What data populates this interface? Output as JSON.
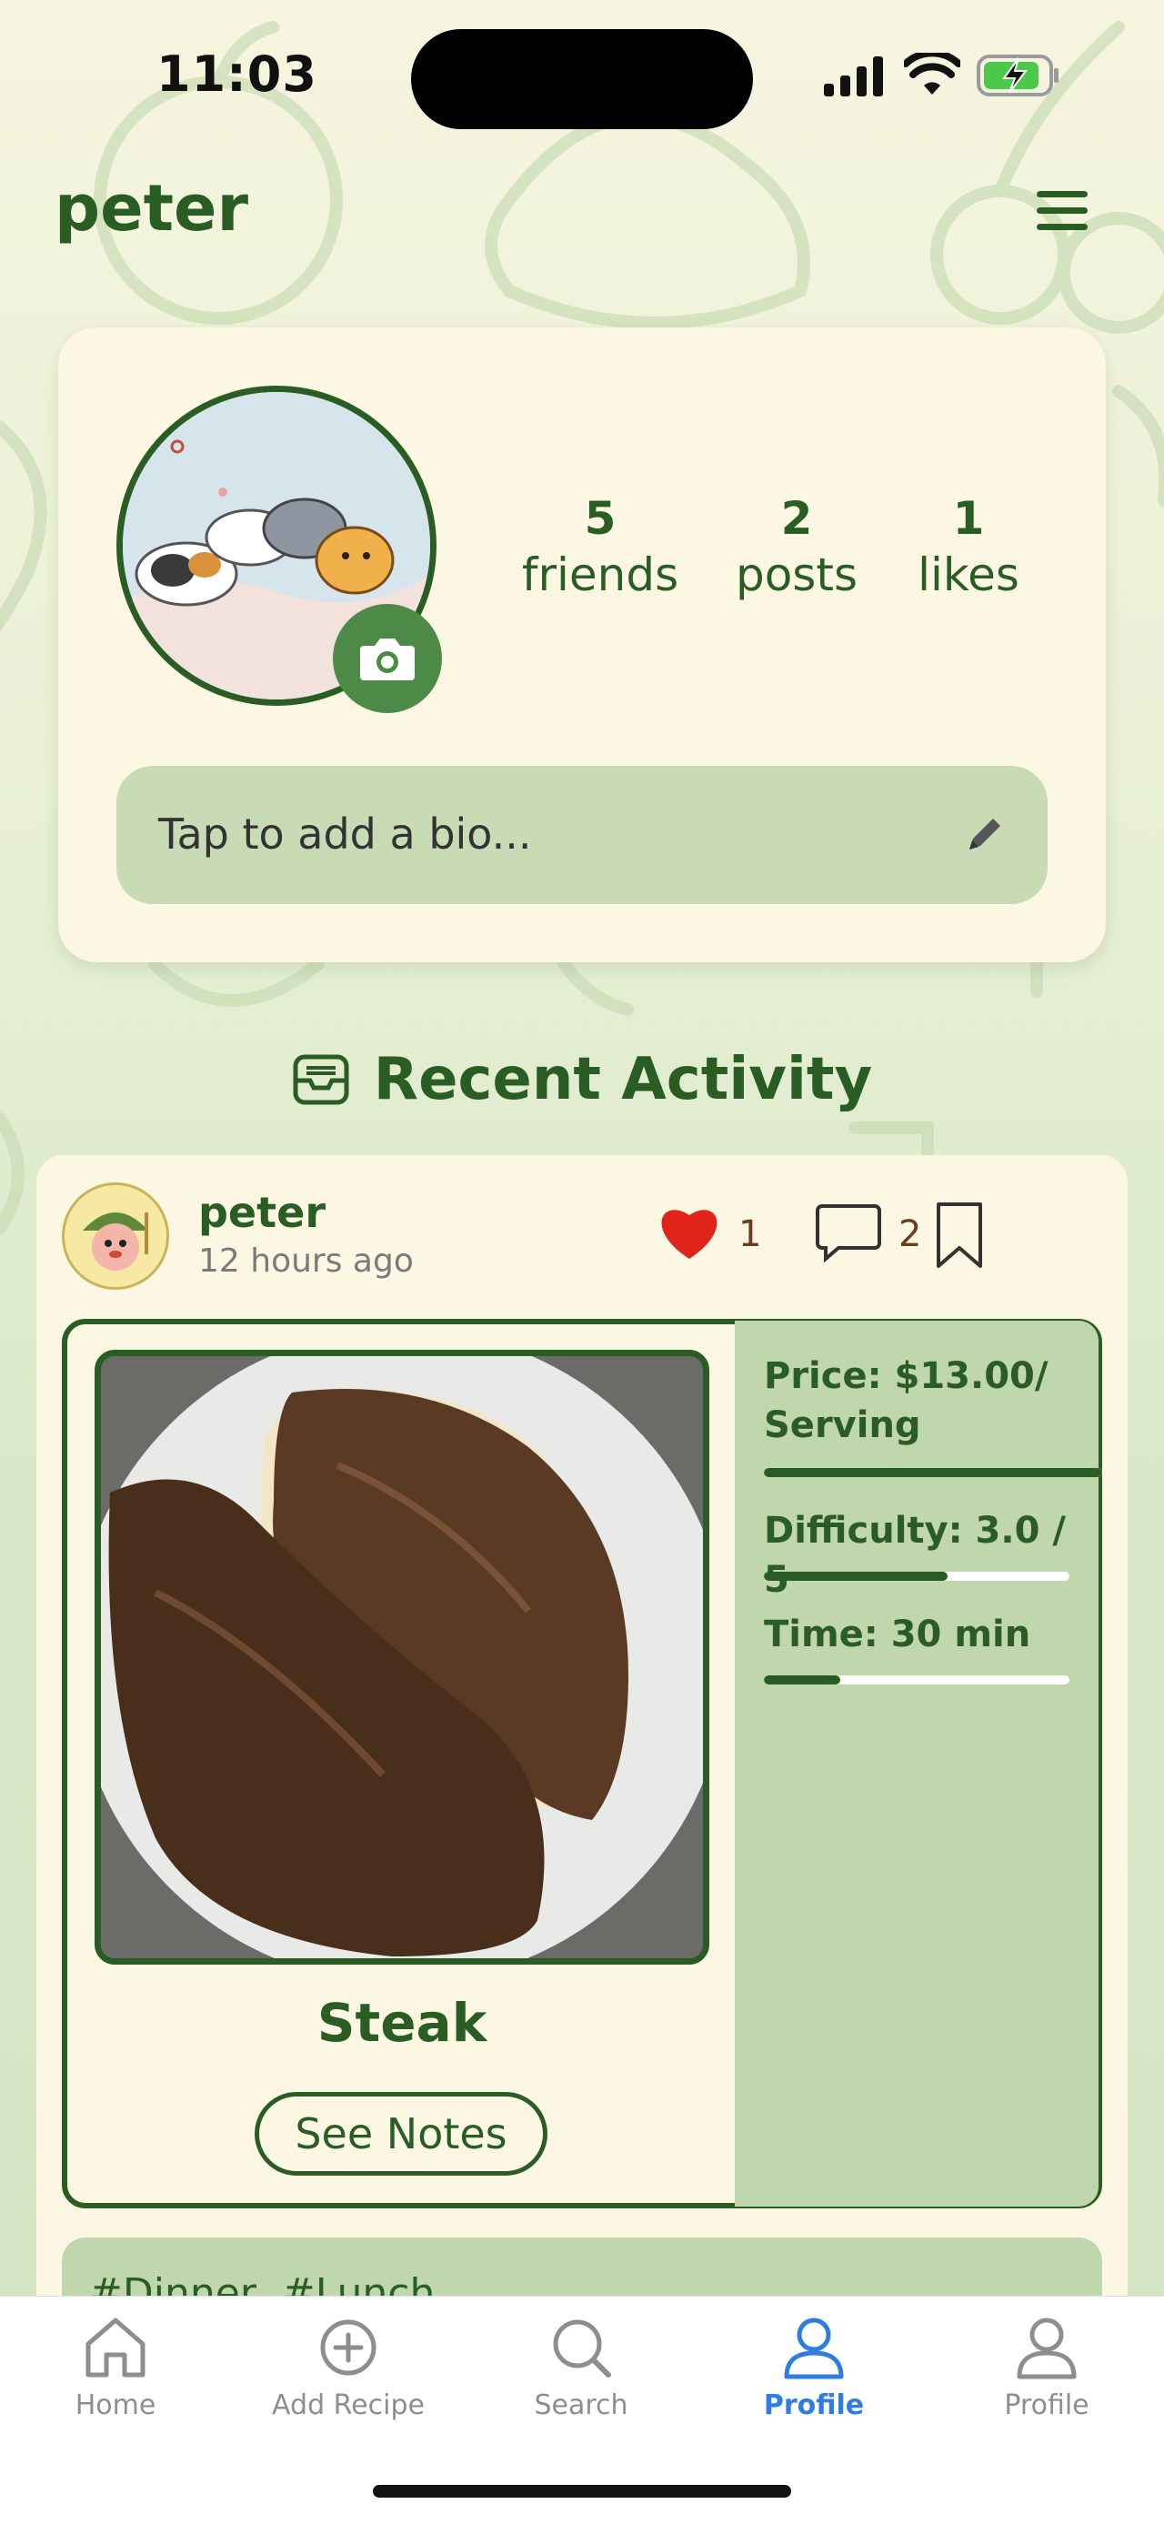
{
  "status_bar": {
    "time": "11:03"
  },
  "header": {
    "username": "peter"
  },
  "profile": {
    "stats": [
      {
        "count": "5",
        "label": "friends"
      },
      {
        "count": "2",
        "label": "posts"
      },
      {
        "count": "1",
        "label": "likes"
      }
    ],
    "bio_placeholder": "Tap to add a bio..."
  },
  "recent_activity": {
    "title": "Recent Activity",
    "post": {
      "author": "peter",
      "time_ago": "12 hours ago",
      "like_count": "1",
      "comment_count": "2",
      "recipe_name": "Steak",
      "notes_button": "See Notes",
      "metrics": {
        "price": "Price: $13.00/ Serving",
        "difficulty": "Difficulty: 3.0 / 5",
        "time": "Time: 30 min"
      },
      "metric_levels": {
        "price": 1.0,
        "difficulty": 0.6,
        "time": 0.25
      },
      "tags": "#Dinner, #Lunch"
    }
  },
  "tab_bar": {
    "items": [
      {
        "label": "Home",
        "icon": "home-icon"
      },
      {
        "label": "Add Recipe",
        "icon": "plus-circle-icon"
      },
      {
        "label": "Search",
        "icon": "search-icon"
      },
      {
        "label": "Profile",
        "icon": "person-icon"
      },
      {
        "label": "Profile",
        "icon": "person-icon"
      }
    ],
    "active_index": 3
  },
  "colors": {
    "accent": "#2a5d24",
    "tab_active": "#2f7de1",
    "like": "#e0241c"
  }
}
